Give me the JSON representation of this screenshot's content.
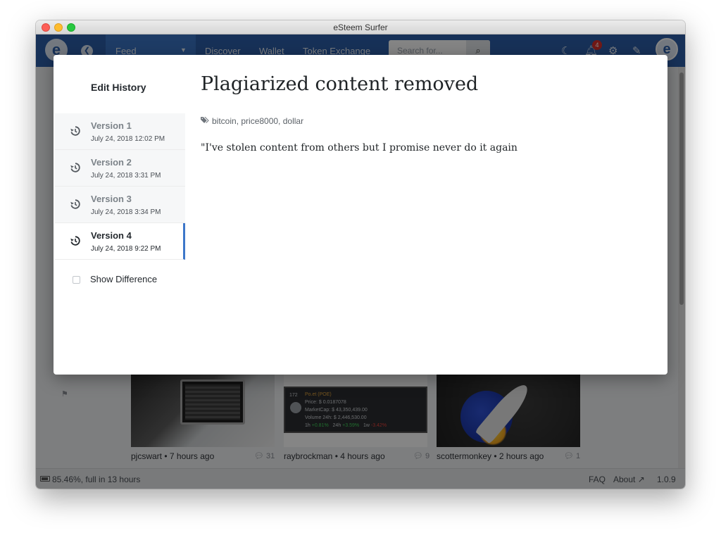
{
  "window": {
    "title": "eSteem Surfer"
  },
  "navbar": {
    "feed": "Feed",
    "discover": "Discover",
    "wallet": "Wallet",
    "token_exchange": "Token Exchange",
    "search_placeholder": "Search for...",
    "notification_count": "4",
    "logo_icon": "esteem-logo-icon",
    "back_icon": "back-arrow-icon",
    "search_icon": "search-icon",
    "moon_icon": "moon-icon",
    "bell_icon": "bell-icon",
    "gear_icon": "gear-icon",
    "pencil_icon": "pencil-icon"
  },
  "feed": {
    "cards": [
      {
        "author": "pjcswart",
        "time": "7 hours ago",
        "comments": "31"
      },
      {
        "author": "raybrockman",
        "time": "4 hours ago",
        "comments": "9",
        "ticker": {
          "rank": "172",
          "name": "Po.et (POE)",
          "price_label": "Price:",
          "price": "$ 0.0187078",
          "mcap_label": "MarketCap:",
          "mcap": "$ 43,350,439.00",
          "vol_label": "Volume 24h:",
          "vol": "$ 2,446,530.00",
          "h1_label": "1h",
          "h1": "+0.81%",
          "h24_label": "24h",
          "h24": "+3.59%",
          "w1_label": "1w",
          "w1": "-3.42%"
        }
      },
      {
        "author": "scottermonkey",
        "time": "2 hours ago",
        "comments": "1"
      }
    ]
  },
  "statusbar": {
    "battery": "85.46%, full in 13 hours",
    "faq": "FAQ",
    "about": "About",
    "version": "1.0.9"
  },
  "modal": {
    "side_title": "Edit History",
    "versions": [
      {
        "label": "Version 1",
        "date": "July 24, 2018 12:02 PM"
      },
      {
        "label": "Version 2",
        "date": "July 24, 2018 3:31 PM"
      },
      {
        "label": "Version 3",
        "date": "July 24, 2018 3:34 PM"
      },
      {
        "label": "Version 4",
        "date": "July 24, 2018 9:22 PM"
      }
    ],
    "selected_version": "Version 4",
    "show_difference": "Show Difference",
    "show_difference_checked": false,
    "post_title": "Plagiarized content removed",
    "tags": "bitcoin, price8000, dollar",
    "body": "\"I've stolen content from others but I promise never do it again",
    "accent_color": "#3d77c9",
    "history_icon": "history-icon",
    "tag_icon": "tags-icon"
  }
}
